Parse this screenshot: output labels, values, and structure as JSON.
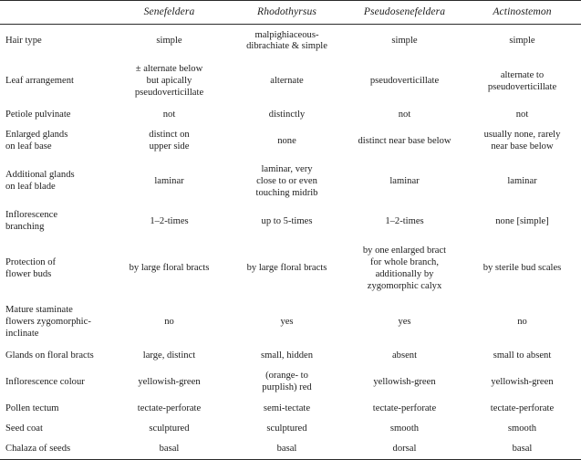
{
  "table": {
    "columns": [
      {
        "key": "character",
        "label": "",
        "align": "left"
      },
      {
        "key": "senefeldera",
        "label": "Senefeldera",
        "align": "center"
      },
      {
        "key": "rhodothyrsus",
        "label": "Rhodothyrsus",
        "align": "center"
      },
      {
        "key": "pseudosenefeldera",
        "label": "Pseudosenefeldera",
        "align": "center"
      },
      {
        "key": "actinostemon",
        "label": "Actinostemon",
        "align": "center"
      }
    ],
    "rows": [
      {
        "label": "Hair type",
        "cells": [
          "simple",
          "malpighiaceous-\ndibrachiate & simple",
          "simple",
          "simple"
        ]
      },
      {
        "label": "Leaf arrangement",
        "cells": [
          "± alternate below\nbut apically\npseudoverticillate",
          "alternate",
          "pseudoverticillate",
          "alternate to\npseudoverticillate"
        ]
      },
      {
        "label": "Petiole pulvinate",
        "cells": [
          "not",
          "distinctly",
          "not",
          "not"
        ]
      },
      {
        "label": "Enlarged glands\non leaf base",
        "cells": [
          "distinct on\nupper side",
          "none",
          "distinct near base below",
          "usually none, rarely\nnear base below"
        ]
      },
      {
        "label": "Additional glands\non leaf blade",
        "cells": [
          "laminar",
          "laminar, very\nclose to or even\ntouching midrib",
          "laminar",
          "laminar"
        ]
      },
      {
        "label": "Inflorescence\nbranching",
        "cells": [
          "1–2-times",
          "up to 5-times",
          "1–2-times",
          "none [simple]"
        ]
      },
      {
        "label": "Protection of\nflower buds",
        "cells": [
          "by large floral bracts",
          "by large floral bracts",
          "by one enlarged bract\nfor whole branch,\nadditionally by\nzygomorphic calyx",
          "by sterile bud scales"
        ]
      },
      {
        "label": "Mature staminate\nflowers zygomorphic-\ninclinate",
        "cells": [
          "no",
          "yes",
          "yes",
          "no"
        ]
      },
      {
        "label": "Glands on floral bracts",
        "cells": [
          "large, distinct",
          "small, hidden",
          "absent",
          "small to absent"
        ]
      },
      {
        "label": "Inflorescence colour",
        "cells": [
          "yellowish-green",
          "(orange- to\npurplish) red",
          "yellowish-green",
          "yellowish-green"
        ]
      },
      {
        "label": "Pollen tectum",
        "cells": [
          "tectate-perforate",
          "semi-tectate",
          "tectate-perforate",
          "tectate-perforate"
        ]
      },
      {
        "label": "Seed coat",
        "cells": [
          "sculptured",
          "sculptured",
          "smooth",
          "smooth"
        ]
      },
      {
        "label": "Chalaza of seeds",
        "cells": [
          "basal",
          "basal",
          "dorsal",
          "basal"
        ]
      }
    ]
  },
  "style": {
    "rule_color": "#2b2b2b",
    "text_color": "#1c1c1c",
    "background": "#ffffff"
  }
}
